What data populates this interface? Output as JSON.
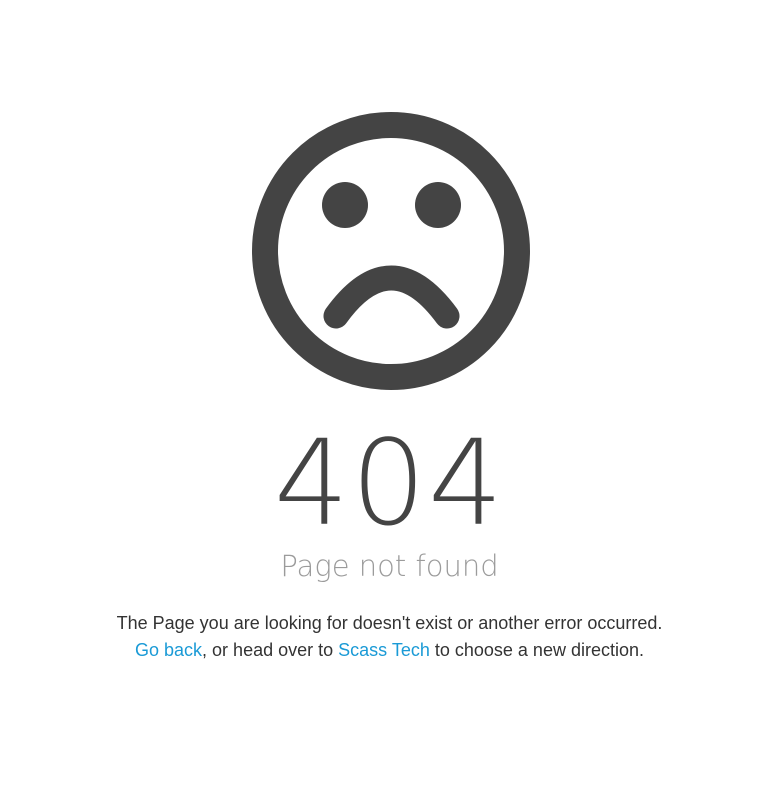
{
  "error": {
    "icon": "sad-face-icon",
    "code": "404",
    "title": "Page not found",
    "message_line1": "The Page you are looking for doesn't exist or another error occurred.",
    "message_line2": {
      "go_back_link": "Go back",
      "middle_text": ", or head over to ",
      "site_link": "Scass Tech",
      "end_text": " to choose a new direction."
    }
  },
  "colors": {
    "icon": "#444444",
    "code": "#444444",
    "subtitle": "#9b9b9b",
    "text": "#333333",
    "link": "#1a9ad6",
    "background": "#ffffff"
  }
}
